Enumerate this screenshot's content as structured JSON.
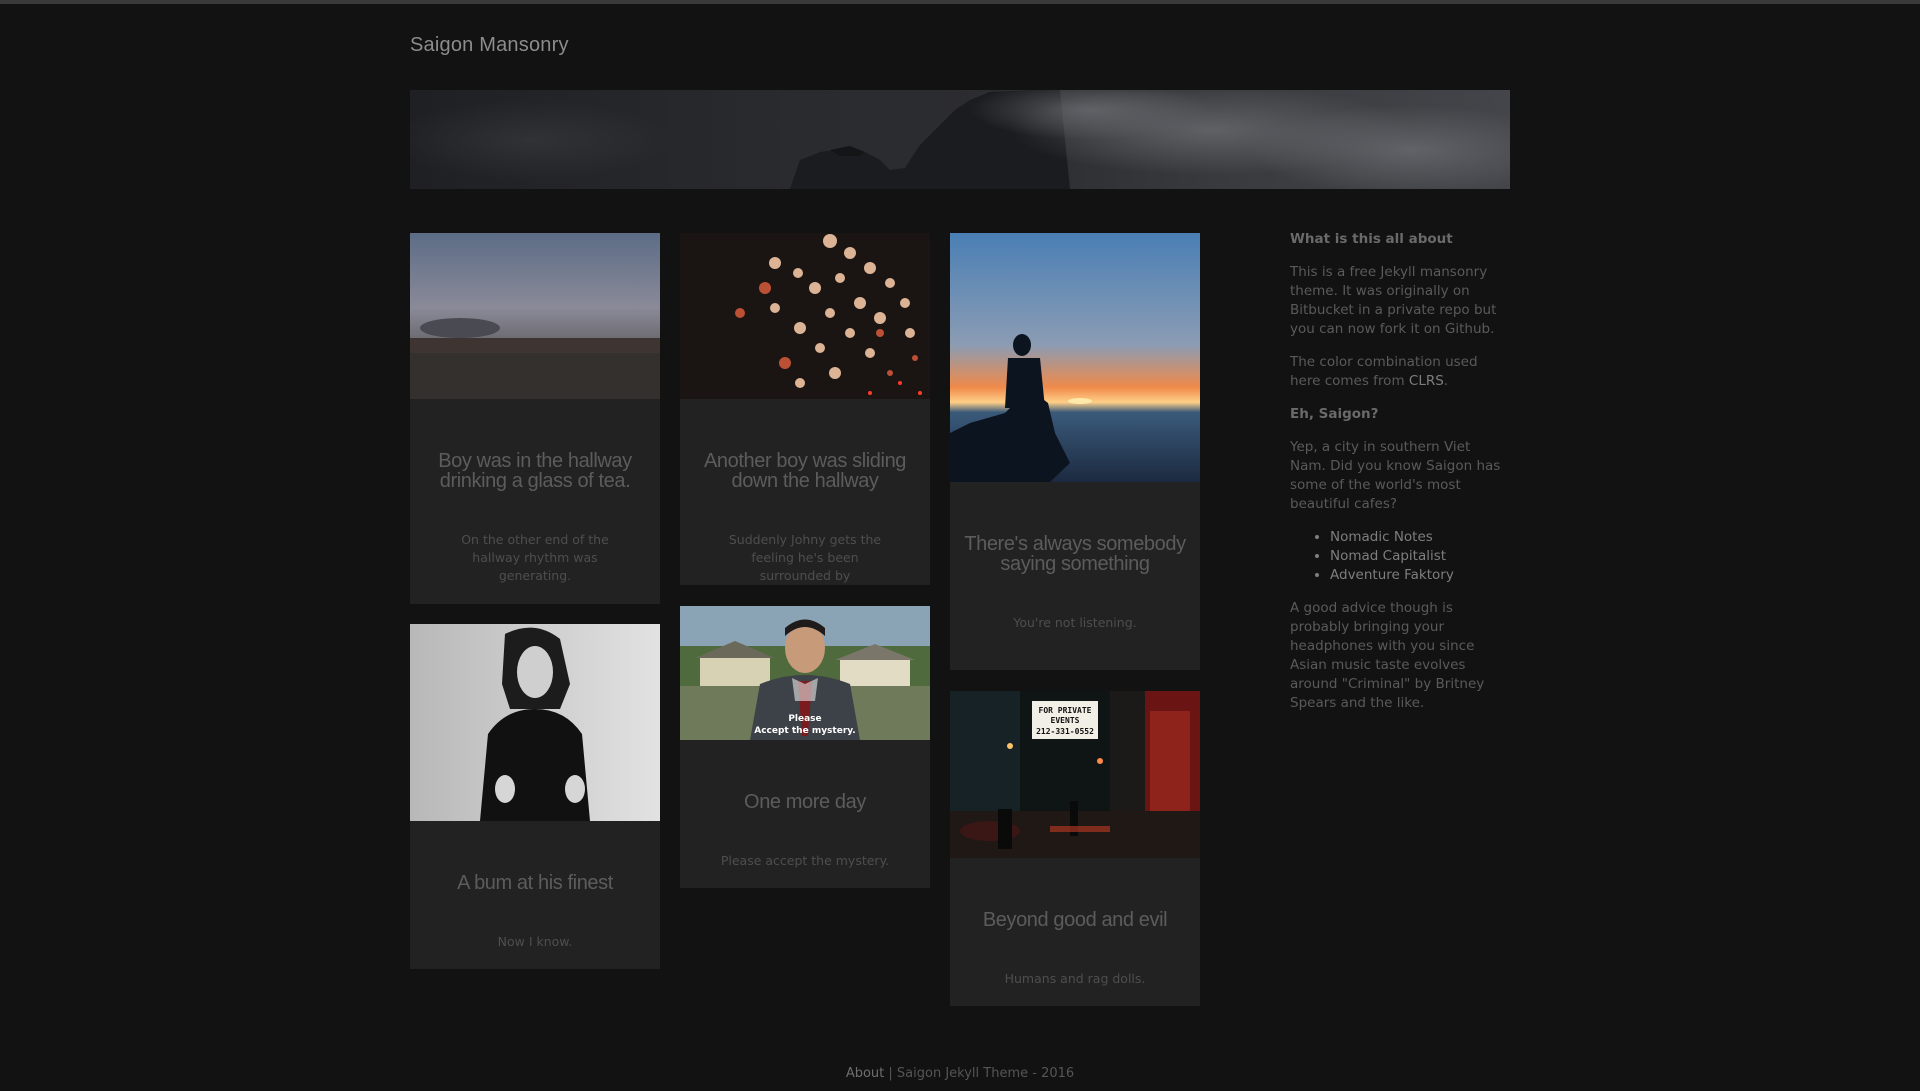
{
  "site": {
    "title": "Saigon Mansonry"
  },
  "posts": [
    {
      "title": "Boy was in the hallway drinking a glass of tea.",
      "excerpt": "On the other end of the hallway rhythm was generating."
    },
    {
      "title": "Another boy was sliding down the hallway",
      "excerpt": "Suddenly Johny gets the feeling he's been surrounded by"
    },
    {
      "title": "There's always somebody saying something",
      "excerpt": "You're not listening."
    },
    {
      "title": "A bum at his finest",
      "excerpt": "Now I know."
    },
    {
      "title": "One more day",
      "excerpt": "Please accept the mystery.",
      "image_caption_1": "Please",
      "image_caption_2": "Accept the mystery."
    },
    {
      "title": "Beyond good and evil",
      "excerpt": "Humans and rag dolls.",
      "image_sign_1": "FOR PRIVATE",
      "image_sign_2": "EVENTS",
      "image_sign_3": "212-331-0552"
    }
  ],
  "sidebar": {
    "heading1": "What is this all about",
    "p1": "This is a free Jekyll mansonry theme. It was originally on Bitbucket in a private repo but you can now fork it on Github.",
    "p2_before": "The color combination used here comes from ",
    "p2_link": "CLRS",
    "p2_after": ".",
    "heading2": "Eh, Saigon?",
    "p3": "Yep, a city in southern Viet Nam. Did you know Saigon has some of the world's most beautiful cafes?",
    "links": [
      "Nomadic Notes",
      "Nomad Capitalist",
      "Adventure Faktory"
    ],
    "p4": "A good advice though is probably bringing your headphones with you since Asian music taste evolves around \"Criminal\" by Britney Spears and the like."
  },
  "footer": {
    "about": "About",
    "separator": " | ",
    "credit": "Saigon Jekyll Theme - 2016"
  },
  "colors": {
    "background": "#121212",
    "card": "#222222",
    "text": "#5a5a5a"
  }
}
